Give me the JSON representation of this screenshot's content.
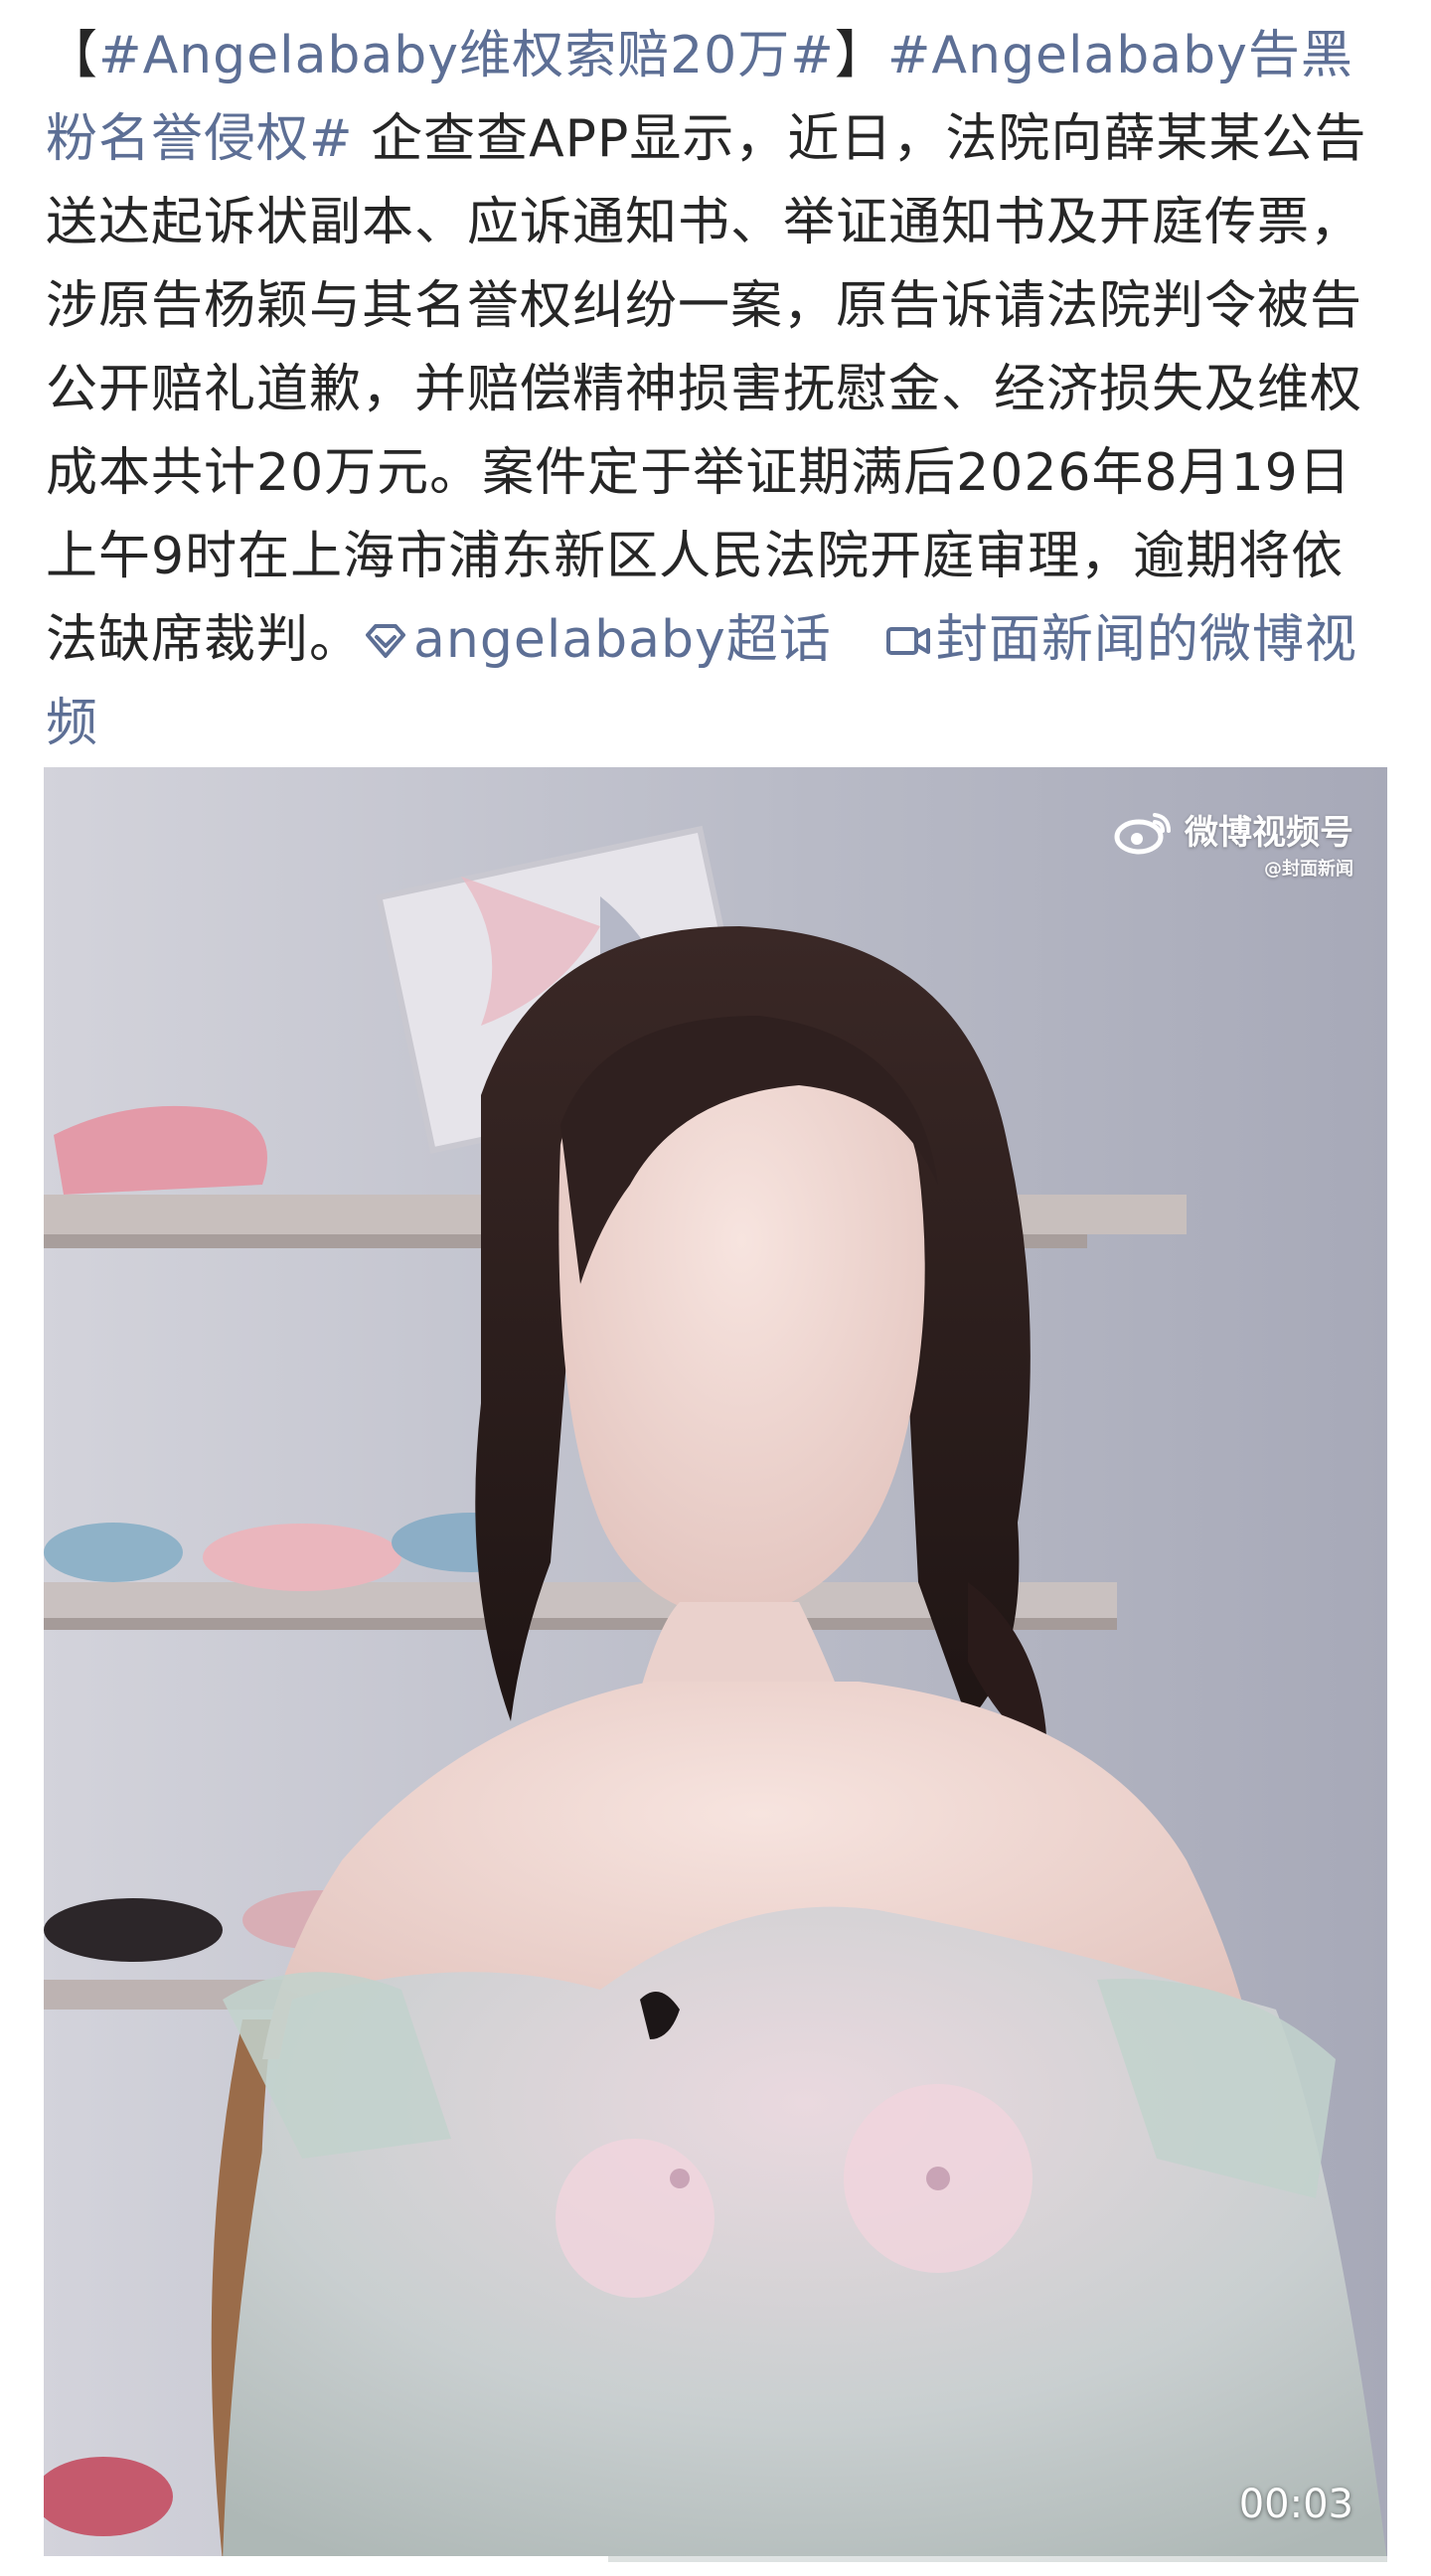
{
  "post": {
    "topic_1": "#Angelababy维权索赔20万#",
    "bracket_open": "【",
    "bracket_close": "】",
    "topic_2": "#Angelababy告黑粉名誉侵权#",
    "body": " 企查查APP显示，近日，法院向薛某某公告送达起诉状副本、应诉通知书、举证通知书及开庭传票，涉原告杨颖与其名誉权纠纷一案，原告诉请法院判令被告公开赔礼道歉，并赔偿精神损害抚慰金、经济损失及维权成本共计20万元。案件定于举证期满后2026年8月19日上午9时在上海市浦东新区人民法院开庭审理，逾期将依法缺席裁判。",
    "supertopic_icon": "diamond-supertopic-icon",
    "supertopic_label": "angelababy超话",
    "video_link_icon": "video-camera-icon",
    "video_link_label": "封面新闻的微博视频"
  },
  "video": {
    "watermark_main": "微博视频号",
    "watermark_logo": "weibo-eye-logo",
    "watermark_sub": "@封面新闻",
    "duration": "00:03",
    "progress": 0.42
  },
  "colors": {
    "text": "#262626",
    "link": "#5d6f95"
  }
}
